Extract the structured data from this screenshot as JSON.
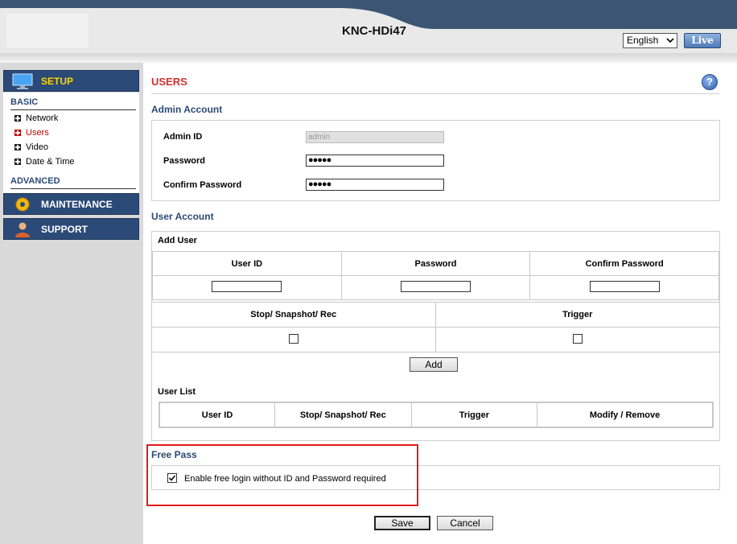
{
  "header": {
    "title": "KNC-HDi47",
    "language": "English",
    "live_label": "Live"
  },
  "sidebar": {
    "setup_label": "SETUP",
    "basic_label": "BASIC",
    "basic_items": [
      {
        "label": "Network"
      },
      {
        "label": "Users"
      },
      {
        "label": "Video"
      },
      {
        "label": "Date & Time"
      }
    ],
    "advanced_label": "ADVANCED",
    "maintenance_label": "MAINTENANCE",
    "support_label": "SUPPORT"
  },
  "main": {
    "page_title": "USERS",
    "help_label": "?",
    "admin": {
      "title": "Admin Account",
      "admin_id_label": "Admin ID",
      "admin_id_value": "admin",
      "password_label": "Password",
      "password_value": "●●●●●",
      "confirm_label": "Confirm Password",
      "confirm_value": "●●●●●"
    },
    "user": {
      "title": "User Account",
      "add_user_label": "Add User",
      "col_user_id": "User ID",
      "col_password": "Password",
      "col_confirm": "Confirm Password",
      "col_stop": "Stop/ Snapshot/ Rec",
      "col_trigger": "Trigger",
      "add_button": "Add",
      "user_list_label": "User List",
      "list_cols": [
        "User ID",
        "Stop/ Snapshot/ Rec",
        "Trigger",
        "Modify / Remove"
      ]
    },
    "free_pass": {
      "title": "Free Pass",
      "enable_label": "Enable free login without ID and Password required",
      "checked": true
    },
    "save_button": "Save",
    "cancel_button": "Cancel"
  },
  "colors": {
    "header_blue": "#3b5573",
    "menu_blue": "#2b4a78",
    "setup_yellow": "#ffd600",
    "title_red": "#d0312d",
    "section_blue": "#2d4a74",
    "highlight_red": "#e11b1b"
  }
}
